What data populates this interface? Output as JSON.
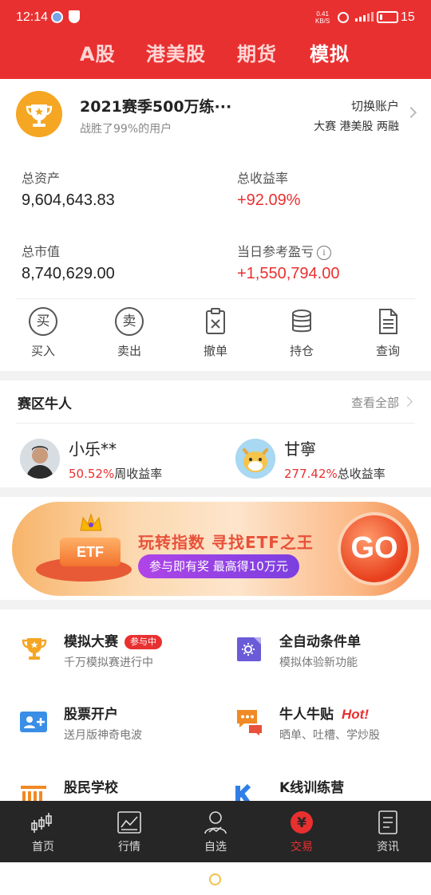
{
  "status_bar": {
    "time": "12:14",
    "net_speed_value": "0.41",
    "net_speed_unit": "KB/S",
    "battery": "15",
    "battery_level": 0.15
  },
  "top_tabs": [
    {
      "label": "A股",
      "active": false
    },
    {
      "label": "港美股",
      "active": false
    },
    {
      "label": "期货",
      "active": false
    },
    {
      "label": "模拟",
      "active": true
    }
  ],
  "account": {
    "name": "2021赛季500万练···",
    "subtitle": "战胜了99%的用户",
    "switch_label": "切换账户",
    "tags": "大赛 港美股 两融"
  },
  "stats": {
    "total_assets_label": "总资产",
    "total_assets_value": "9,604,643.83",
    "total_return_label": "总收益率",
    "total_return_value": "+92.09%",
    "market_value_label": "总市值",
    "market_value_value": "8,740,629.00",
    "daily_pnl_label": "当日参考盈亏",
    "daily_pnl_value": "+1,550,794.00",
    "info_glyph": "i"
  },
  "actions": [
    {
      "label": "买入",
      "glyph": "买",
      "icon": "buy-icon"
    },
    {
      "label": "卖出",
      "glyph": "卖",
      "icon": "sell-icon"
    },
    {
      "label": "撤单",
      "icon": "cancel-order-icon"
    },
    {
      "label": "持仓",
      "icon": "holdings-icon"
    },
    {
      "label": "查询",
      "icon": "query-icon"
    }
  ],
  "top_traders": {
    "title": "赛区牛人",
    "view_all": "查看全部",
    "traders": [
      {
        "name": "小乐**",
        "pct": "50.52%",
        "metric": "周收益率"
      },
      {
        "name": "甘寧",
        "pct": "277.42%",
        "metric": "总收益率"
      }
    ]
  },
  "banner": {
    "etf_label": "ETF",
    "headline": "玩转指数  寻找ETF之王",
    "pill": "参与即有奖  最高得10万元",
    "go": "GO"
  },
  "features": [
    {
      "title": "模拟大赛",
      "badge": "参与中",
      "subtitle": "千万模拟赛进行中",
      "icon": "trophy-icon"
    },
    {
      "title": "全自动条件单",
      "subtitle": "模拟体验新功能",
      "icon": "auto-order-icon"
    },
    {
      "title": "股票开户",
      "subtitle": "送月版神奇电波",
      "icon": "open-account-icon"
    },
    {
      "title": "牛人牛贴",
      "hot": "Hot!",
      "subtitle": "晒单、吐槽、学炒股",
      "icon": "chat-icon"
    },
    {
      "title": "股民学校",
      "icon": "school-icon"
    },
    {
      "title": "K线训练营",
      "icon": "k-line-icon"
    }
  ],
  "bottom_nav": [
    {
      "label": "首页",
      "icon": "candlestick-icon",
      "active": false
    },
    {
      "label": "行情",
      "icon": "market-chart-icon",
      "active": false
    },
    {
      "label": "自选",
      "icon": "watchlist-user-icon",
      "active": false
    },
    {
      "label": "交易",
      "glyph": "¥",
      "icon": "yuan-icon",
      "active": true
    },
    {
      "label": "资讯",
      "icon": "news-icon",
      "active": false
    }
  ],
  "colors": {
    "brand_red": "#e93030",
    "trophy_orange": "#f5a623",
    "nav_bg": "#262626"
  }
}
